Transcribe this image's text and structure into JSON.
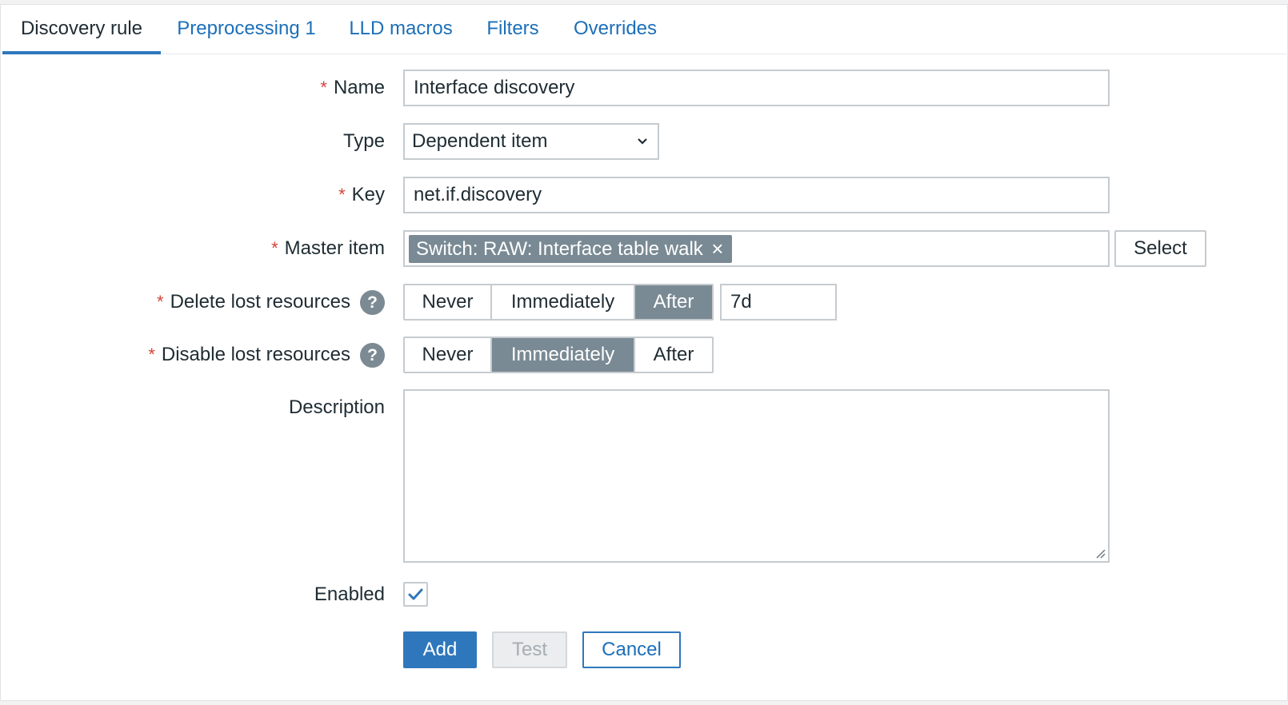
{
  "tabs": [
    {
      "label": "Discovery rule",
      "active": true
    },
    {
      "label": "Preprocessing 1",
      "active": false
    },
    {
      "label": "LLD macros",
      "active": false
    },
    {
      "label": "Filters",
      "active": false
    },
    {
      "label": "Overrides",
      "active": false
    }
  ],
  "form": {
    "required_marker": "*",
    "help_glyph": "?",
    "name": {
      "label": "Name",
      "value": "Interface discovery"
    },
    "type": {
      "label": "Type",
      "selected": "Dependent item"
    },
    "key": {
      "label": "Key",
      "value": "net.if.discovery"
    },
    "master_item": {
      "label": "Master item",
      "chip": "Switch: RAW: Interface table walk",
      "chip_remove": "×",
      "select_label": "Select"
    },
    "delete_lost": {
      "label": "Delete lost resources",
      "options": [
        "Never",
        "Immediately",
        "After"
      ],
      "selected": "After",
      "after_value": "7d"
    },
    "disable_lost": {
      "label": "Disable lost resources",
      "options": [
        "Never",
        "Immediately",
        "After"
      ],
      "selected": "Immediately"
    },
    "description": {
      "label": "Description",
      "value": ""
    },
    "enabled": {
      "label": "Enabled",
      "checked": true
    }
  },
  "buttons": {
    "add": "Add",
    "test": "Test",
    "cancel": "Cancel"
  },
  "colors": {
    "accent": "#2f77bc",
    "link": "#1d6fb8",
    "required": "#d6433b",
    "segment_selected": "#7a8a94"
  }
}
